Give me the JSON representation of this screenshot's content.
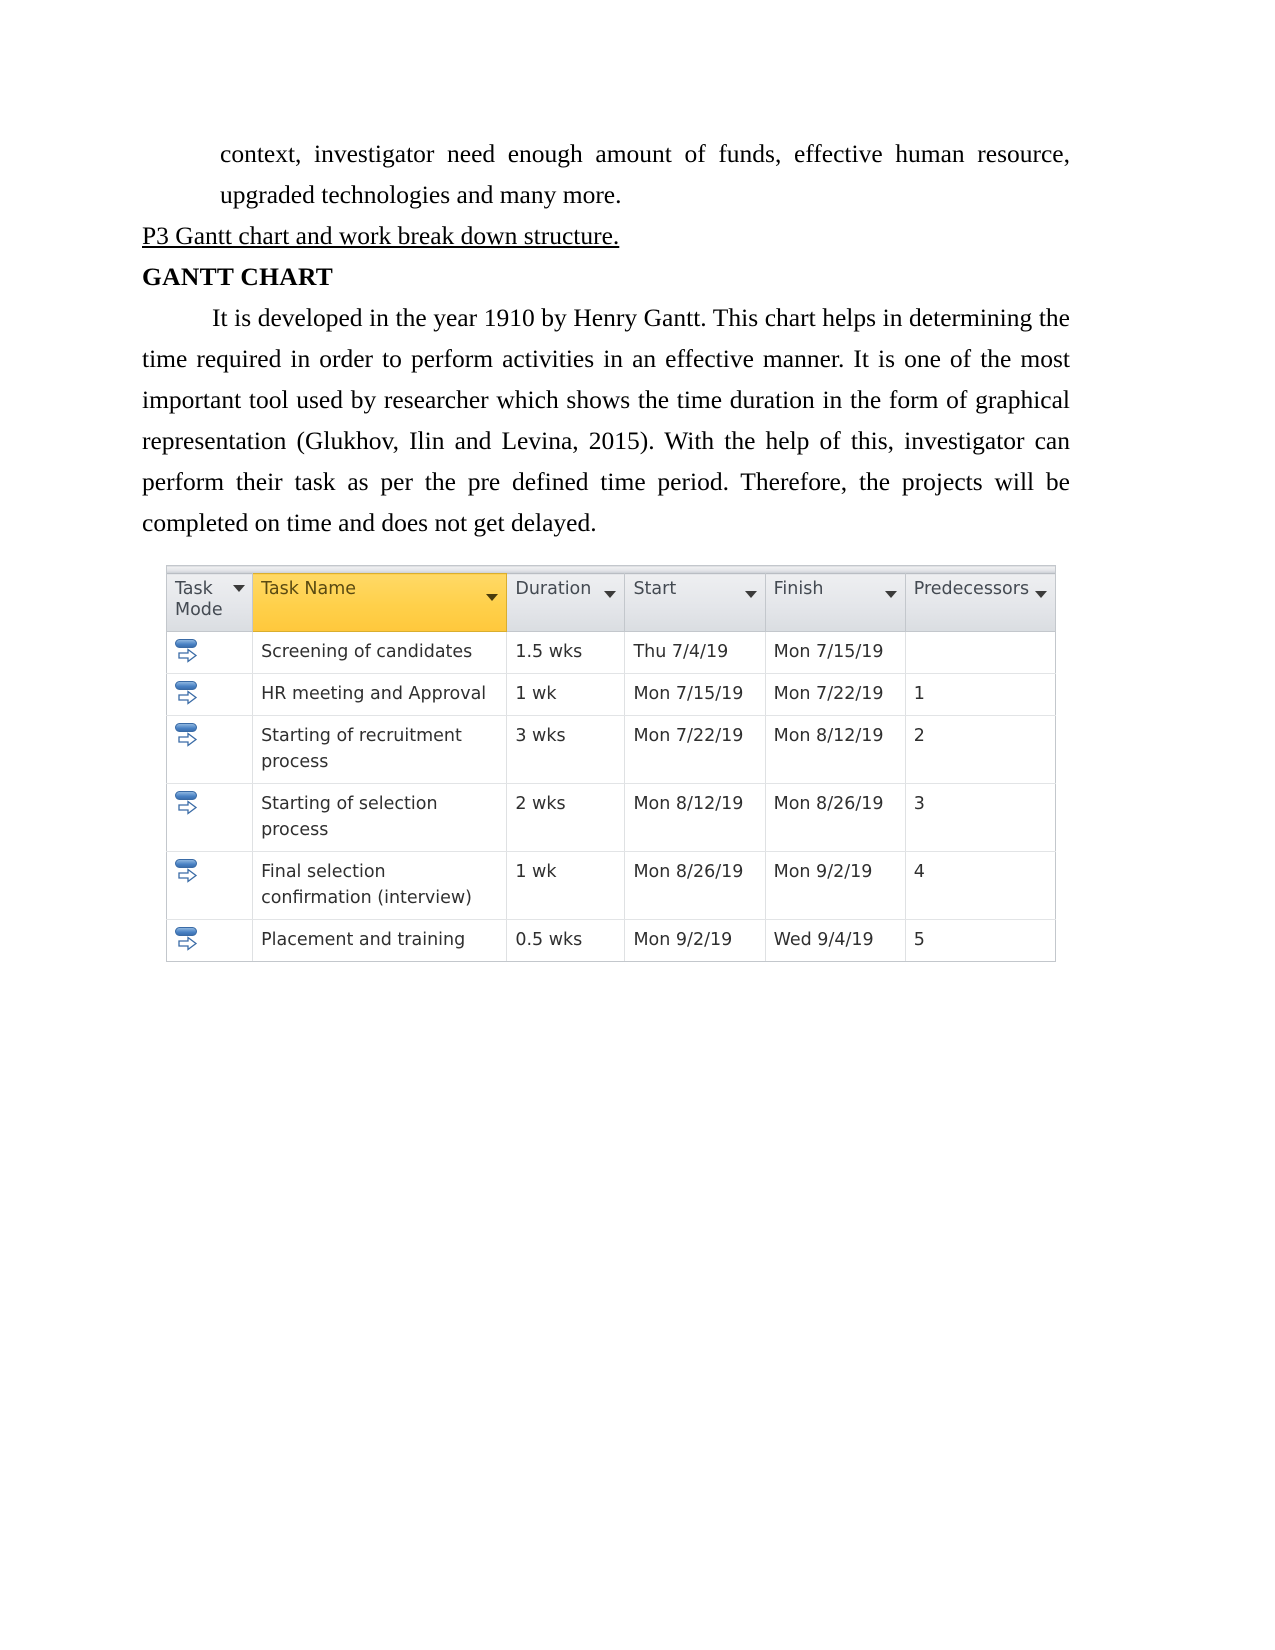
{
  "document": {
    "paragraph_top": "context, investigator need enough amount of funds, effective human resource, upgraded technologies and many more.",
    "section_heading": "P3  Gantt chart and work break down structure.",
    "subheading": "GANTT CHART",
    "gantt_paragraph": "It is developed in the year 1910 by Henry Gantt. This chart helps in determining the time required in order to perform activities in an effective manner. It is one of the most important tool used by researcher which shows the time duration in the form of graphical representation (Glukhov, Ilin and Levina, 2015). With the help of this, investigator can perform their task as per the pre defined time period. Therefore, the projects will be completed on time and does not get delayed."
  },
  "chart_data": {
    "type": "table",
    "title": "GANTT CHART",
    "columns": [
      {
        "key": "task_mode",
        "label": "Task Mode",
        "sortable": true,
        "highlighted": false
      },
      {
        "key": "task_name",
        "label": "Task Name",
        "sortable": true,
        "highlighted": true
      },
      {
        "key": "duration",
        "label": "Duration",
        "sortable": true,
        "highlighted": false
      },
      {
        "key": "start",
        "label": "Start",
        "sortable": true,
        "highlighted": false
      },
      {
        "key": "finish",
        "label": "Finish",
        "sortable": true,
        "highlighted": false
      },
      {
        "key": "predecessors",
        "label": "Predecessors",
        "sortable": true,
        "highlighted": false
      }
    ],
    "rows": [
      {
        "task_mode_icon": "auto-scheduled-icon",
        "task_name": "Screening of candidates",
        "duration": "1.5 wks",
        "start": "Thu 7/4/19",
        "finish": "Mon 7/15/19",
        "predecessors": ""
      },
      {
        "task_mode_icon": "auto-scheduled-icon",
        "task_name": "HR meeting and Approval",
        "duration": "1 wk",
        "start": "Mon 7/15/19",
        "finish": "Mon 7/22/19",
        "predecessors": "1"
      },
      {
        "task_mode_icon": "auto-scheduled-icon",
        "task_name": "Starting of recruitment process",
        "duration": "3 wks",
        "start": "Mon 7/22/19",
        "finish": "Mon 8/12/19",
        "predecessors": "2"
      },
      {
        "task_mode_icon": "auto-scheduled-icon",
        "task_name": "Starting of selection process",
        "duration": "2 wks",
        "start": "Mon 8/12/19",
        "finish": "Mon 8/26/19",
        "predecessors": "3"
      },
      {
        "task_mode_icon": "auto-scheduled-icon",
        "task_name": "Final selection confirmation (interview)",
        "duration": "1 wk",
        "start": "Mon 8/26/19",
        "finish": "Mon 9/2/19",
        "predecessors": "4"
      },
      {
        "task_mode_icon": "auto-scheduled-icon",
        "task_name": "Placement and training",
        "duration": "0.5 wks",
        "start": "Mon 9/2/19",
        "finish": "Wed 9/4/19",
        "predecessors": "5"
      }
    ],
    "colors": {
      "header_background": "#e4e6ea",
      "header_highlight": "#ffd04a",
      "header_text": "#444a52",
      "grid_line": "#e2e4e6",
      "border": "#c3c7cc",
      "icon_blue": "#4a82c4"
    }
  }
}
